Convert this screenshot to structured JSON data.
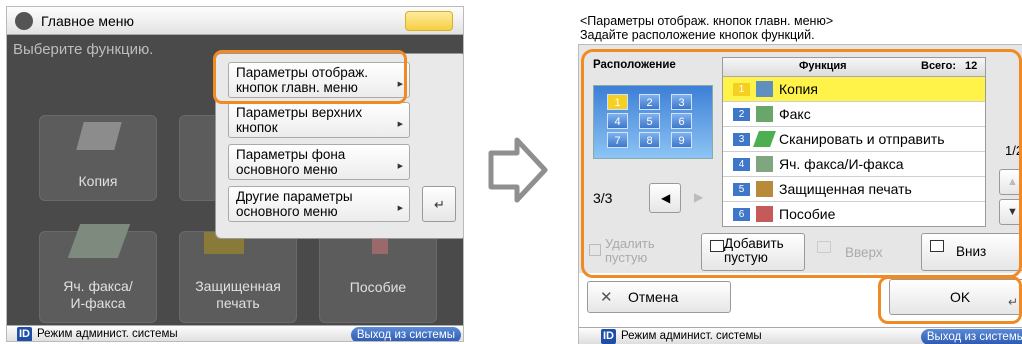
{
  "left": {
    "title": "Главное меню",
    "prompt": "Выберите функцию.",
    "tiles": [
      {
        "label": "Копия"
      },
      {
        "label": "Яч. факса/\nИ-факса"
      },
      {
        "label": "Защищенная\nпечать"
      },
      {
        "label": "Пособие"
      }
    ],
    "menu": {
      "items": [
        {
          "label": "Параметры отображ.\nкнопок главн. меню"
        },
        {
          "label": "Параметры верхних\nкнопок"
        },
        {
          "label": "Параметры фона\nосновного меню"
        },
        {
          "label": "Другие параметры\nосновного меню"
        }
      ],
      "enter_label": "↵"
    },
    "footer": {
      "id_badge": "ID",
      "mode": "Режим админист. системы",
      "logout": "Выход из системы"
    }
  },
  "right": {
    "header_line1": "<Параметры отображ. кнопок главн. меню>",
    "header_line2": "Задайте расположение кнопок функций.",
    "layout_label": "Расположение",
    "layout_grid": [
      "1",
      "2",
      "3",
      "4",
      "5",
      "6",
      "7",
      "8",
      "9"
    ],
    "page_of": "3/3",
    "list_header": {
      "function": "Функция",
      "total": "Всего:",
      "total_count": "12"
    },
    "list_items": [
      {
        "num": "1",
        "label": "Копия",
        "selected": true
      },
      {
        "num": "2",
        "label": "Факс"
      },
      {
        "num": "3",
        "label": "Сканировать и отправить"
      },
      {
        "num": "4",
        "label": "Яч. факса/И-факса"
      },
      {
        "num": "5",
        "label": "Защищенная печать"
      },
      {
        "num": "6",
        "label": "Пособие"
      }
    ],
    "scroll_page": "1/2",
    "actions": {
      "delete_empty": "Удалить\nпустую",
      "add_empty": "Добавить\nпустую",
      "up": "Вверх",
      "down": "Вниз"
    },
    "cancel": "Отмена",
    "ok": "OK",
    "footer": {
      "id_badge": "ID",
      "mode": "Режим админист. системы",
      "logout": "Выход из системы"
    }
  },
  "colors": {
    "highlight": "#f08a24",
    "selected_row": "#fff34a",
    "accent_blue": "#3f77c8"
  }
}
